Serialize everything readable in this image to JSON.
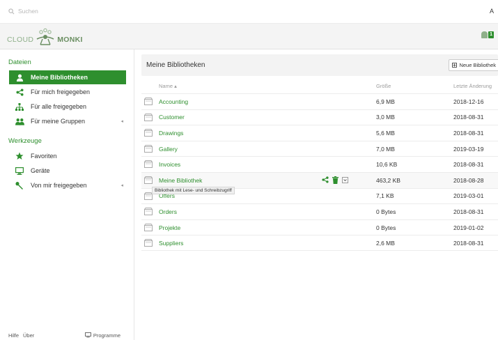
{
  "search": {
    "placeholder": "Suchen"
  },
  "topbar": {
    "right_text": "A"
  },
  "logo": {
    "left": "CLOUD",
    "right": "MONKI"
  },
  "notifications": {
    "count": "1"
  },
  "sidebar": {
    "section_files": "Dateien",
    "items_files": [
      {
        "label": "Meine Bibliotheken",
        "icon": "user-icon",
        "active": true
      },
      {
        "label": "Für mich freigegeben",
        "icon": "share-icon"
      },
      {
        "label": "Für alle freigegeben",
        "icon": "sitemap-icon"
      },
      {
        "label": "Für meine Gruppen",
        "icon": "group-icon",
        "arrow": "◂"
      }
    ],
    "section_tools": "Werkzeuge",
    "items_tools": [
      {
        "label": "Favoriten",
        "icon": "star-icon"
      },
      {
        "label": "Geräte",
        "icon": "monitor-icon"
      },
      {
        "label": "Von mir freigegeben",
        "icon": "wrench-icon",
        "arrow": "◂"
      }
    ],
    "footer": {
      "help": "Hilfe",
      "about": "Über",
      "programs": "Programme"
    }
  },
  "main": {
    "title": "Meine Bibliotheken",
    "new_library_button": "Neue Bibliothek",
    "columns": {
      "name": "Name ▴",
      "size": "Größe",
      "modified": "Letzte Änderung"
    },
    "rows": [
      {
        "name": "Accounting",
        "size": "6,9 MB",
        "date": "2018-12-16"
      },
      {
        "name": "Customer",
        "size": "3,0 MB",
        "date": "2018-08-31"
      },
      {
        "name": "Drawings",
        "size": "5,6 MB",
        "date": "2018-08-31"
      },
      {
        "name": "Gallery",
        "size": "7,0 MB",
        "date": "2019-03-19"
      },
      {
        "name": "Invoices",
        "size": "10,6 KB",
        "date": "2018-08-31"
      },
      {
        "name": "Meine Bibliothek",
        "size": "463,2 KB",
        "date": "2018-08-28"
      },
      {
        "name": "Offers",
        "size": "7,1 KB",
        "date": "2019-03-01"
      },
      {
        "name": "Orders",
        "size": "0 Bytes",
        "date": "2018-08-31"
      },
      {
        "name": "Projekte",
        "size": "0 Bytes",
        "date": "2019-01-02"
      },
      {
        "name": "Suppliers",
        "size": "2,6 MB",
        "date": "2018-08-31"
      }
    ],
    "tooltip": "Bibliothek mit Lese- und Schreibzugriff"
  },
  "colors": {
    "accent": "#2e8f2e",
    "header_bg": "#f3f3f3",
    "logo_green": "#6b8f62"
  }
}
